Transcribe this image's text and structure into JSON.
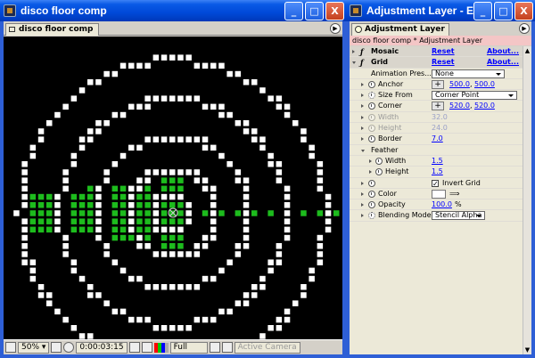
{
  "comp_window": {
    "title": "disco floor comp",
    "tab_label": "disco floor comp",
    "controls": {
      "minimize": "_",
      "maximize": "□",
      "close": "X"
    },
    "statusbar": {
      "zoom": "50%",
      "timecode": "0:00:03:15",
      "resolution": "Full",
      "camera": "Active Camera"
    },
    "grid": {
      "background": "#000000",
      "cell_color": "#ffffff",
      "glow_color": "#22dd22"
    }
  },
  "effect_window": {
    "title": "Adjustment Layer - Effect...",
    "tab_label": "Adjustment Layer",
    "breadcrumb": "disco floor comp * Adjustment Layer",
    "effects": [
      {
        "name": "Mosaic",
        "reset": "Reset",
        "about": "About..."
      },
      {
        "name": "Grid",
        "reset": "Reset",
        "about": "About..."
      }
    ],
    "params": {
      "animation_presets": {
        "label": "Animation Pres...",
        "value": "None"
      },
      "anchor": {
        "label": "Anchor",
        "x": "500.0",
        "y": "500.0"
      },
      "size_from": {
        "label": "Size From",
        "value": "Corner Point"
      },
      "corner": {
        "label": "Corner",
        "x": "520.0",
        "y": "520.0"
      },
      "width": {
        "label": "Width",
        "value": "32.0"
      },
      "height": {
        "label": "Height",
        "value": "24.0"
      },
      "border": {
        "label": "Border",
        "value": "7.0"
      },
      "feather": {
        "label": "Feather"
      },
      "feather_width": {
        "label": "Width",
        "value": "1.5"
      },
      "feather_height": {
        "label": "Height",
        "value": "1.5"
      },
      "invert": {
        "label": "Invert Grid",
        "checked": "✓"
      },
      "color": {
        "label": "Color"
      },
      "opacity": {
        "label": "Opacity",
        "value": "100.0",
        "unit": "%"
      },
      "blending_mode": {
        "label": "Blending Mode",
        "value": "Stencil Alpha"
      }
    }
  }
}
